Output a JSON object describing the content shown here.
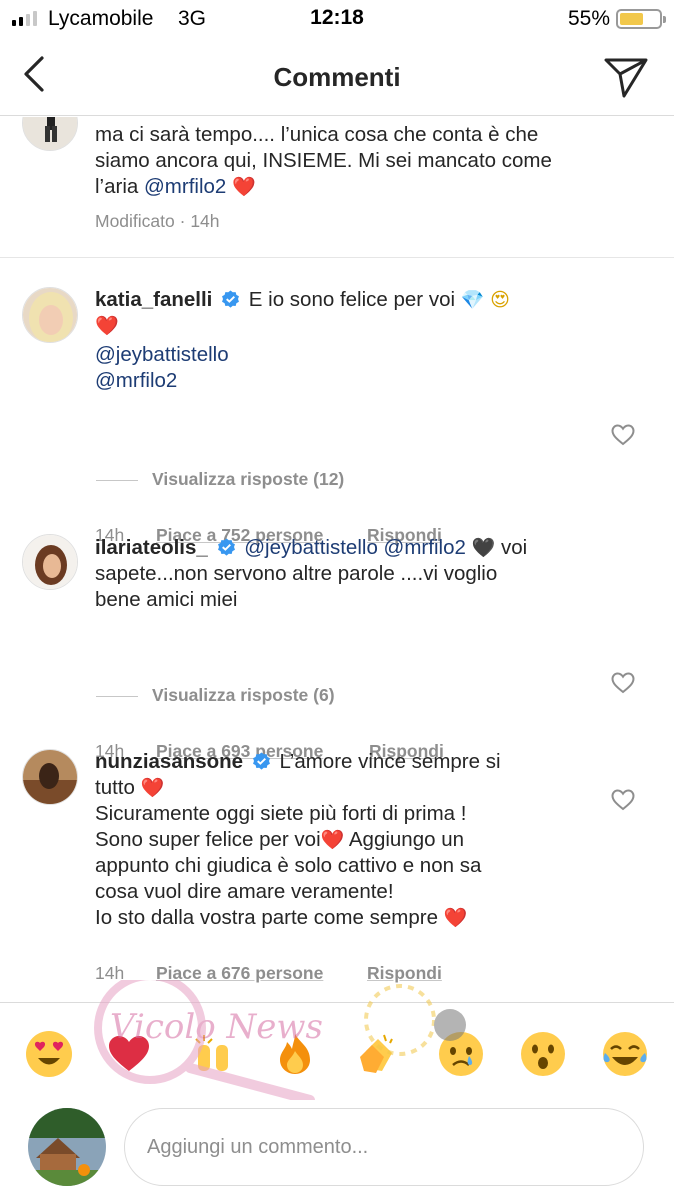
{
  "status_bar": {
    "carrier": "Lycamobile",
    "network": "3G",
    "time": "12:18",
    "battery_percent": "55%",
    "battery_level": 0.55,
    "signal_bars_filled": 2,
    "signal_bars_total": 4
  },
  "header": {
    "title": "Commenti",
    "back_icon": "chevron-left-icon",
    "direct_icon": "paper-plane-icon"
  },
  "comments": [
    {
      "text_lines": [
        "ma ci sarà tempo.... l’unica cosa che conta è che",
        "siamo ancora qui, INSIEME. Mi sei mancato come",
        "l’aria "
      ],
      "mention": "@mrfilo2",
      "trailing_emoji": "❤️",
      "edited_label": "Modificato",
      "time": "14h"
    },
    {
      "username": "katia_fanelli",
      "verified": true,
      "text": "E io sono felice per voi",
      "emojis": [
        "💎",
        "😍",
        "❤️"
      ],
      "mentions": [
        "@jeybattistello",
        "@mrfilo2"
      ],
      "time": "14h",
      "likes_label": "Piace a 752 persone",
      "reply_label": "Rispondi",
      "view_replies": "Visualizza risposte (12)"
    },
    {
      "username": "ilariateolis_",
      "verified": true,
      "mentions": [
        "@jeybattistello",
        "@mrfilo2"
      ],
      "emoji": "🖤",
      "text_after": "voi",
      "text_lines": [
        "sapete...non servono altre parole ....vi voglio",
        "bene amici miei"
      ],
      "time": "14h",
      "likes_label": "Piace a 693 persone",
      "reply_label": "Rispondi",
      "view_replies": "Visualizza risposte (6)"
    },
    {
      "username": "nunziasansone",
      "verified": true,
      "text_first": "L’amore vince sempre si",
      "text_second": "tutto",
      "emoji": "❤️",
      "text_lines": [
        "Sicuramente oggi siete più forti di prima !",
        "Sono super felice per voi",
        " Aggiungo un",
        "appunto chi giudica è solo cattivo e non sa",
        "cosa vuol dire amare veramente!",
        "Io sto dalla vostra parte come sempre "
      ],
      "time": "14h",
      "likes_label": "Piace a 676 persone",
      "reply_label": "Rispondi"
    }
  ],
  "emoji_bar": [
    "😍",
    "❤️",
    "🙌",
    "🔥",
    "👏",
    "😢",
    "😮",
    "😂"
  ],
  "watermark": {
    "text": "Vicolo News"
  },
  "comment_input": {
    "placeholder": "Aggiungi un commento..."
  },
  "colors": {
    "mention": "#1d3c74",
    "secondary_text": "#8e8e8e",
    "verified": "#3897f0",
    "heart": "#e0245e",
    "battery": "#f2c84b"
  }
}
